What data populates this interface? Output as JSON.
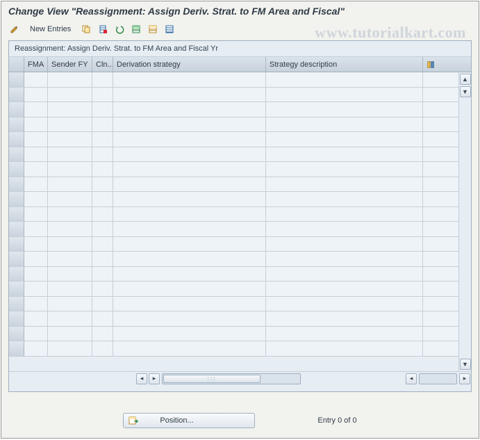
{
  "title": "Change View \"Reassignment: Assign Deriv. Strat. to FM Area and Fiscal\"",
  "watermark": "www.tutorialkart.com",
  "toolbar": {
    "new_entries": "New Entries"
  },
  "panel": {
    "title": "Reassignment: Assign Deriv. Strat. to FM Area and Fiscal Yr"
  },
  "columns": {
    "fma": "FMA",
    "sender_fy": "Sender FY",
    "cln": "Cln...",
    "derivation_strategy": "Derivation strategy",
    "strategy_description": "Strategy description"
  },
  "footer": {
    "position_label": "Position...",
    "entry_text": "Entry 0 of 0"
  },
  "icons": {
    "toggle": "toggle-icon",
    "copy": "copy-icon",
    "delete": "delete-icon",
    "undo": "undo-icon",
    "select_all": "select-all-icon",
    "select_block": "select-block-icon",
    "deselect_all": "deselect-all-icon",
    "config": "table-settings-icon",
    "position": "position-icon"
  }
}
